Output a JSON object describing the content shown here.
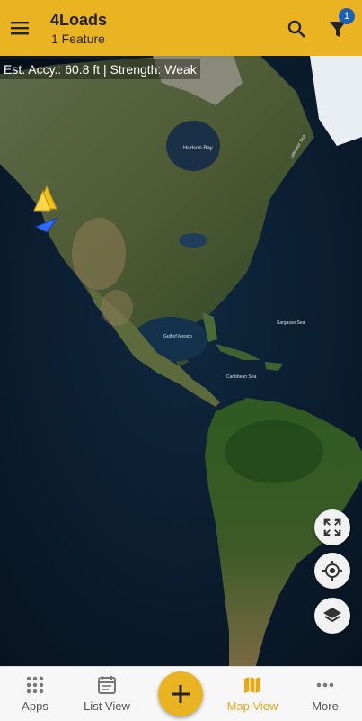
{
  "header": {
    "title": "4Loads",
    "subtitle": "1 Feature",
    "filter_badge": "1"
  },
  "map": {
    "accuracy_text": "Est. Accy.: 60.8 ft | Strength: Weak",
    "labels": {
      "hudson_bay": "Hudson Bay",
      "labrador_sea": "Labrador Sea",
      "gulf_of_mexico": "Gulf of Mexico",
      "sargasso_sea": "Sargasso Sea",
      "caribbean_sea": "Caribbean Sea"
    }
  },
  "bottom_nav": {
    "items": [
      {
        "label": "Apps"
      },
      {
        "label": "List View"
      },
      {
        "label": "Map View"
      },
      {
        "label": "More"
      }
    ]
  },
  "colors": {
    "accent": "#eab321",
    "active_nav": "#e7a91a",
    "badge": "#1b5fb6"
  }
}
